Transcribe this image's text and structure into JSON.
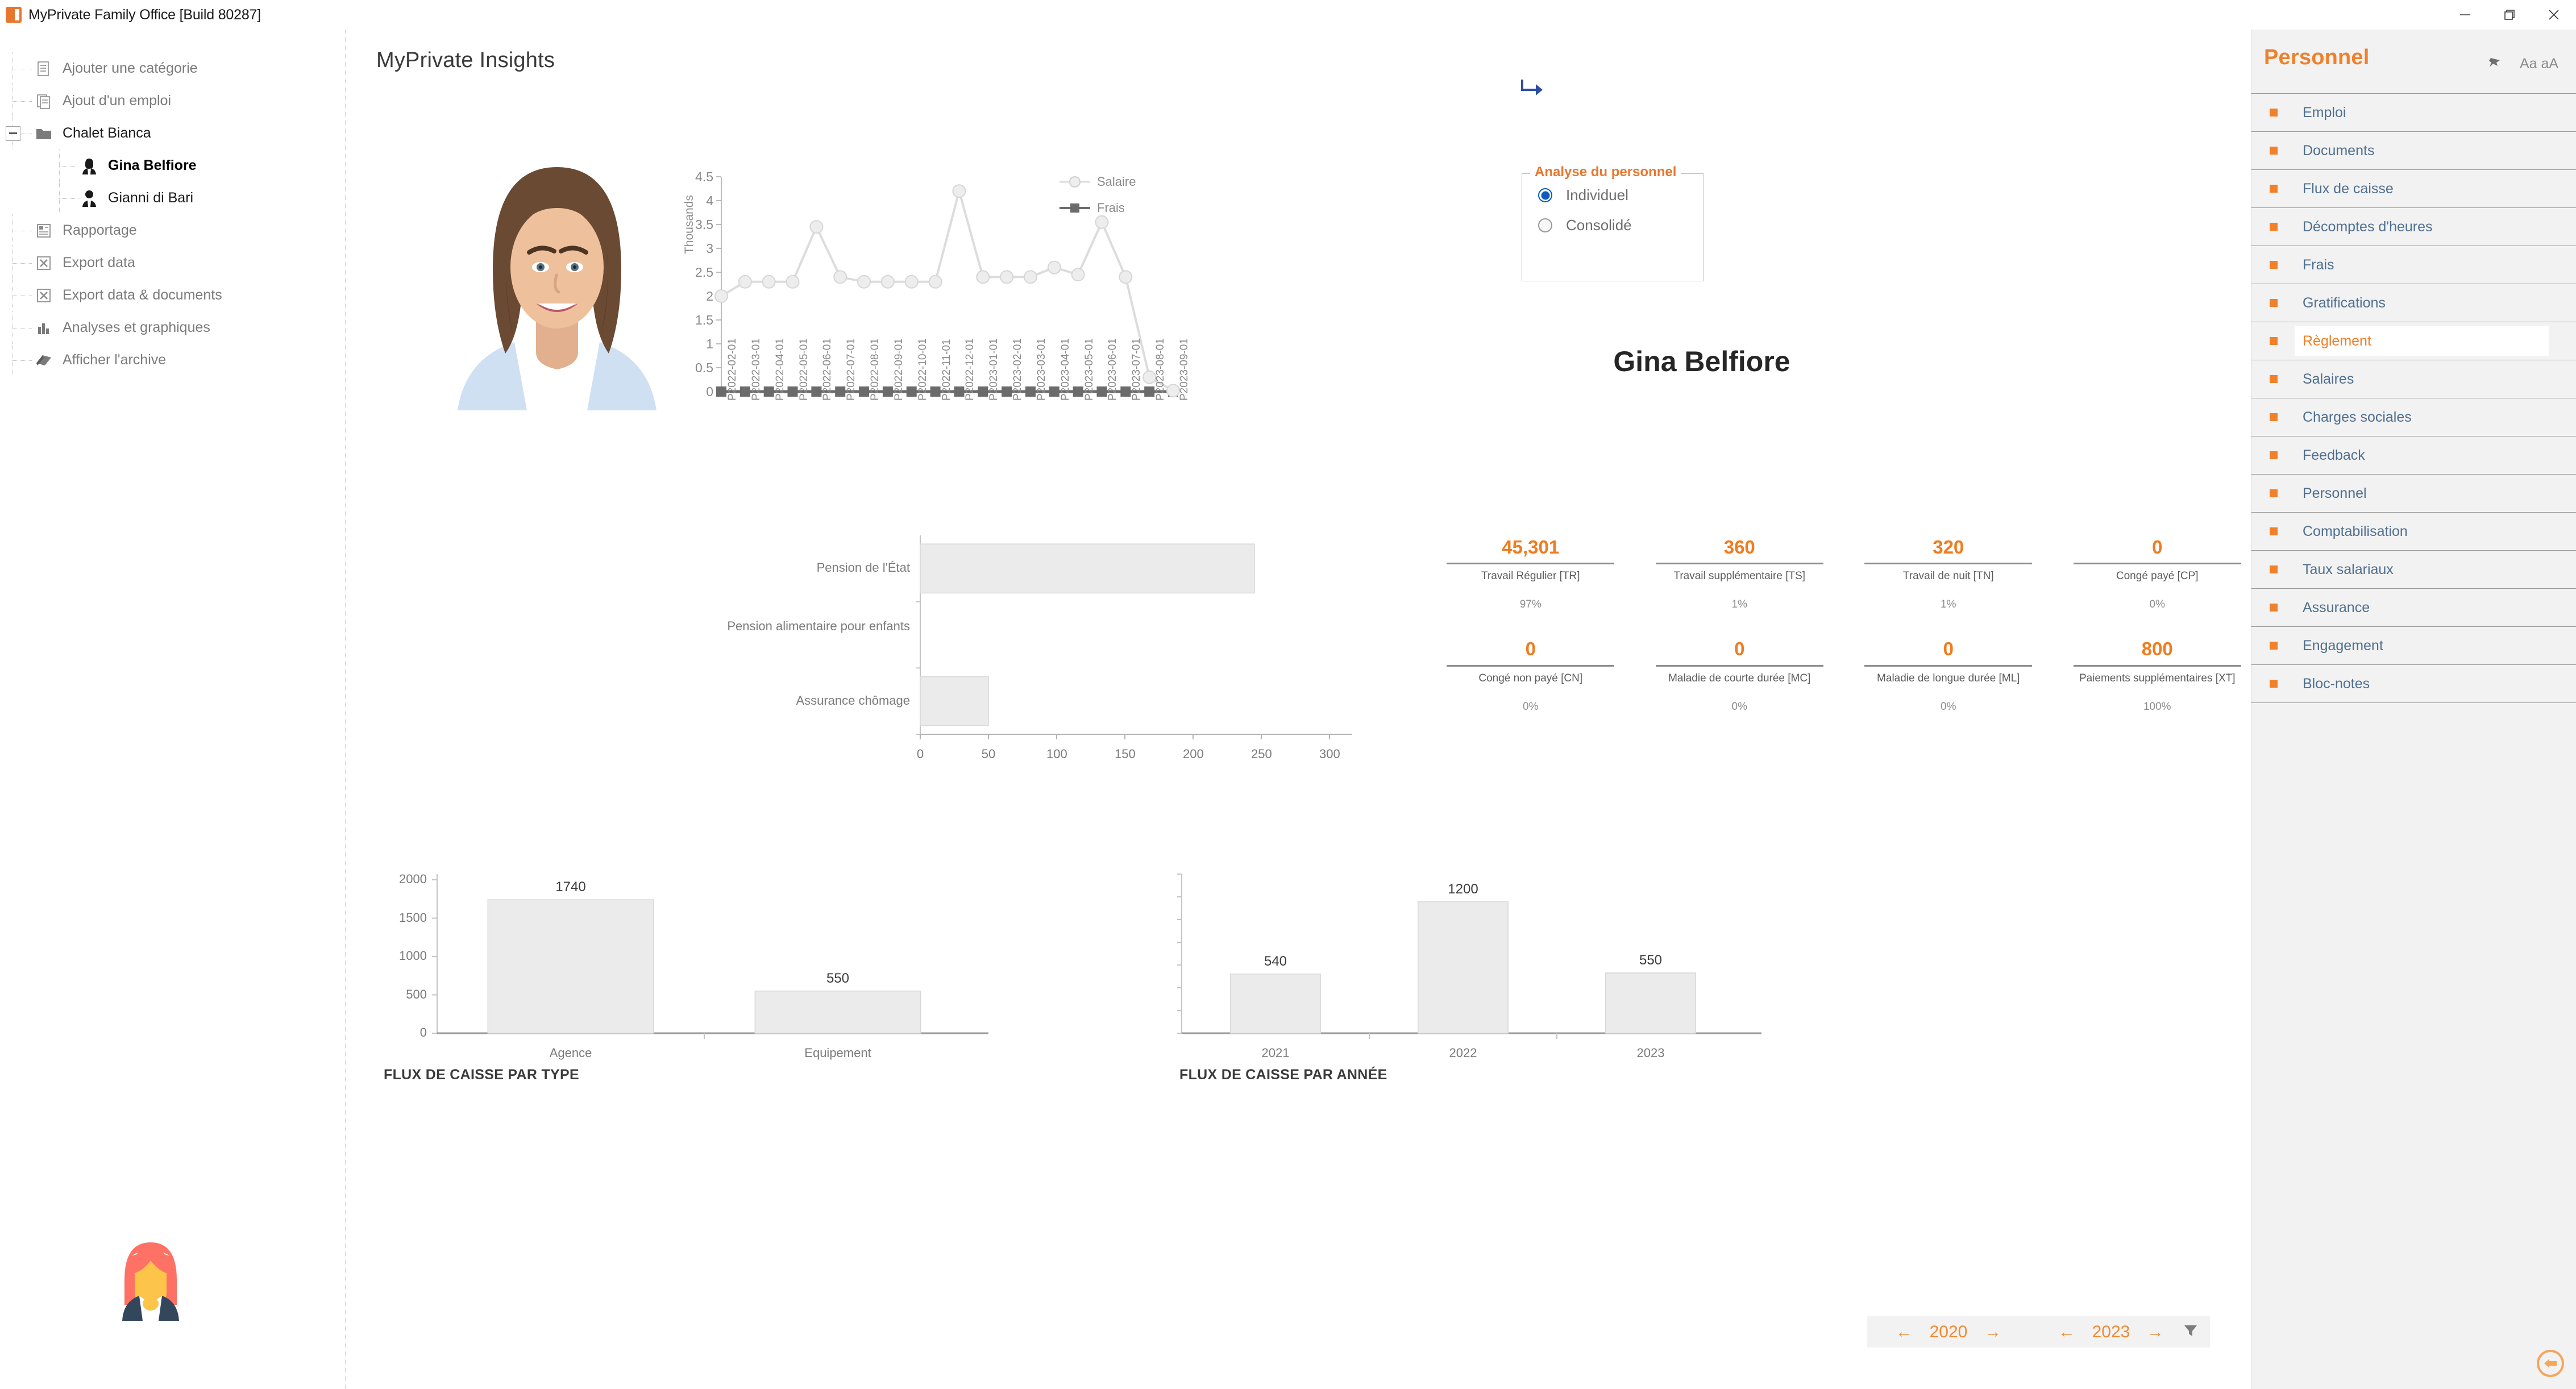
{
  "window": {
    "title": "MyPrivate Family Office [Build 80287]",
    "app_icon": "app-logo-icon",
    "minimize": "–",
    "restore": "restore-icon",
    "close": "✕"
  },
  "sidebar": {
    "items": [
      {
        "label": "Ajouter une catégorie",
        "icon": "document-add-icon",
        "level": 0,
        "state": "normal"
      },
      {
        "label": "Ajout d'un emploi",
        "icon": "job-add-icon",
        "level": 0,
        "state": "normal"
      },
      {
        "label": "Chalet Bianca",
        "icon": "folder-icon",
        "level": 0,
        "state": "dark",
        "expanded": true
      },
      {
        "label": "Gina Belfiore",
        "icon": "person-female-icon",
        "level": 1,
        "state": "selected"
      },
      {
        "label": "Gianni di Bari",
        "icon": "person-male-icon",
        "level": 1,
        "state": "dark"
      },
      {
        "label": "Rapportage",
        "icon": "report-icon",
        "level": 0,
        "state": "normal"
      },
      {
        "label": "Export data",
        "icon": "export-icon",
        "level": 0,
        "state": "normal"
      },
      {
        "label": "Export data & documents",
        "icon": "export-icon",
        "level": 0,
        "state": "normal"
      },
      {
        "label": "Analyses et graphiques",
        "icon": "bar-chart-icon",
        "level": 0,
        "state": "normal"
      },
      {
        "label": "Afficher l'archive",
        "icon": "archive-book-icon",
        "level": 0,
        "state": "normal"
      }
    ],
    "mascot": "avatar-mascot-icon"
  },
  "main": {
    "page_title": "MyPrivate Insights",
    "return_icon": "return-arrow-icon",
    "portrait": "employee-portrait",
    "person_name": "Gina Belfiore",
    "analysis_box": {
      "title": "Analyse du personnel",
      "options": [
        {
          "label": "Individuel",
          "selected": true
        },
        {
          "label": "Consolidé",
          "selected": false
        }
      ]
    },
    "legend": [
      {
        "label": "Salaire",
        "marker": "circle",
        "color": "#e0e0e0"
      },
      {
        "label": "Frais",
        "marker": "square",
        "color": "#6b6b6b"
      }
    ],
    "kpis": [
      {
        "value": "45,301",
        "name": "Travail Régulier [TR]",
        "pct": "97%"
      },
      {
        "value": "360",
        "name": "Travail supplémentaire [TS]",
        "pct": "1%"
      },
      {
        "value": "320",
        "name": "Travail de nuit [TN]",
        "pct": "1%"
      },
      {
        "value": "0",
        "name": "Congé payé [CP]",
        "pct": "0%"
      },
      {
        "value": "0",
        "name": "Congé non payé [CN]",
        "pct": "0%"
      },
      {
        "value": "0",
        "name": "Maladie de courte durée [MC]",
        "pct": "0%"
      },
      {
        "value": "0",
        "name": "Maladie de longue durée [ML]",
        "pct": "0%"
      },
      {
        "value": "800",
        "name": "Paiements supplémentaires [XT]",
        "pct": "100%"
      }
    ],
    "year_nav": {
      "from_prev": "←",
      "from_year": "2020",
      "from_next": "→",
      "to_prev": "←",
      "to_year": "2023",
      "to_next": "→",
      "filter_icon": "funnel-filter-icon"
    },
    "back_fab": "back-circle-icon"
  },
  "right_panel": {
    "title": "Personnel",
    "pin_icon": "pin-icon",
    "font_size_label": "Aa aA",
    "items": [
      {
        "label": "Emploi",
        "active": false
      },
      {
        "label": "Documents",
        "active": false
      },
      {
        "label": "Flux de caisse",
        "active": false
      },
      {
        "label": "Décomptes d'heures",
        "active": false
      },
      {
        "label": "Frais",
        "active": false
      },
      {
        "label": "Gratifications",
        "active": false
      },
      {
        "label": "Règlement",
        "active": true
      },
      {
        "label": "Salaires",
        "active": false
      },
      {
        "label": "Charges sociales",
        "active": false
      },
      {
        "label": "Feedback",
        "active": false
      },
      {
        "label": "Personnel",
        "active": false
      },
      {
        "label": "Comptabilisation",
        "active": false
      },
      {
        "label": "Taux salariaux",
        "active": false
      },
      {
        "label": "Assurance",
        "active": false
      },
      {
        "label": "Engagement",
        "active": false
      },
      {
        "label": "Bloc-notes",
        "active": false
      }
    ]
  },
  "colors": {
    "accent_orange": "#f0802a",
    "link_blue": "#4f6f8f",
    "panel_bg": "#f2f2f2",
    "series_salaire": "#e0e0e0",
    "series_frais": "#6b6b6b",
    "bar_fill": "#eaeaea"
  },
  "chart_data": [
    {
      "type": "line",
      "title": "",
      "xlabel": "",
      "ylabel": "Thousands",
      "ylim": [
        0,
        4.5
      ],
      "yticks": [
        0,
        0.5,
        1,
        1.5,
        2,
        2.5,
        3,
        3.5,
        4,
        4.5
      ],
      "grid": false,
      "legend_position": "right",
      "categories": [
        "P2022-02-01",
        "P2022-03-01",
        "P2022-04-01",
        "P2022-05-01",
        "P2022-06-01",
        "P2022-07-01",
        "P2022-08-01",
        "P2022-09-01",
        "P2022-10-01",
        "P2022-11-01",
        "P2022-12-01",
        "P2023-01-01",
        "P2023-02-01",
        "P2023-03-01",
        "P2023-04-01",
        "P2023-05-01",
        "P2023-06-01",
        "P2023-07-01",
        "P2023-08-01",
        "P2023-09-01"
      ],
      "series": [
        {
          "name": "Salaire",
          "marker": "circle",
          "color": "#e0e0e0",
          "values": [
            2.0,
            2.3,
            2.3,
            2.3,
            3.45,
            2.4,
            2.3,
            2.3,
            2.3,
            2.3,
            4.2,
            2.4,
            2.4,
            2.4,
            2.6,
            2.45,
            3.55,
            2.4,
            0.3,
            0.02
          ]
        },
        {
          "name": "Frais",
          "marker": "square",
          "color": "#6b6b6b",
          "values": [
            0,
            0,
            0,
            0,
            0,
            0,
            0,
            0,
            0,
            0,
            0,
            0,
            0,
            0,
            0,
            0,
            0,
            0,
            0,
            0
          ]
        }
      ]
    },
    {
      "type": "bar",
      "orientation": "horizontal",
      "title": "",
      "xlabel": "",
      "ylabel": "",
      "xlim": [
        0,
        300
      ],
      "xticks": [
        0,
        50,
        100,
        150,
        200,
        250,
        300
      ],
      "categories": [
        "Pension de l'État",
        "Pension alimentaire pour enfants",
        "Assurance chômage"
      ],
      "values": [
        245,
        0,
        50
      ]
    },
    {
      "type": "bar",
      "title": "FLUX DE CAISSE PAR TYPE",
      "xlabel": "",
      "ylabel": "",
      "ylim": [
        0,
        2000
      ],
      "yticks": [
        0,
        500,
        1000,
        1500,
        2000
      ],
      "categories": [
        "Agence",
        "Equipement"
      ],
      "values": [
        1740,
        550
      ],
      "data_labels": [
        "1740",
        "550"
      ]
    },
    {
      "type": "bar",
      "title": "FLUX DE CAISSE PAR ANNÉE",
      "xlabel": "",
      "ylabel": "",
      "ylim": [
        0,
        1400
      ],
      "yticks": [],
      "categories": [
        "2021",
        "2022",
        "2023"
      ],
      "values": [
        540,
        1200,
        550
      ],
      "data_labels": [
        "540",
        "1200",
        "550"
      ]
    }
  ]
}
